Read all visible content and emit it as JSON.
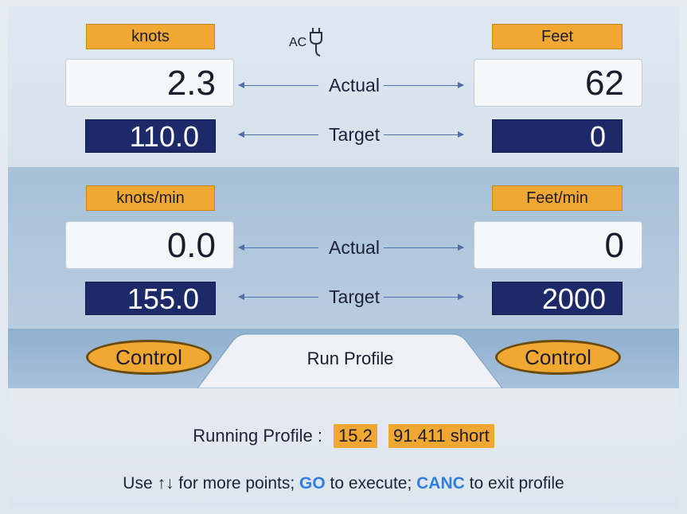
{
  "top": {
    "left_unit": "knots",
    "right_unit": "Feet",
    "power_label": "AC",
    "actual_label": "Actual",
    "target_label": "Target",
    "left_actual": "2.3",
    "left_target": "110.0",
    "right_actual": "62",
    "right_target": "0"
  },
  "middle": {
    "left_unit": "knots/min",
    "right_unit": "Feet/min",
    "actual_label": "Actual",
    "target_label": "Target",
    "left_actual": "0.0",
    "left_target": "155.0",
    "right_actual": "0",
    "right_target": "2000"
  },
  "tabs": {
    "left_control": "Control",
    "center": "Run Profile",
    "right_control": "Control"
  },
  "status": {
    "running_label": "Running Profile :",
    "value_1": "15.2",
    "value_2": "91.411 short"
  },
  "hint": {
    "part1": "Use ↑↓ for more points; ",
    "go": "GO",
    "part2": " to execute; ",
    "canc": "CANC",
    "part3": " to exit profile"
  },
  "colors": {
    "orange": "#f0a832",
    "navy": "#1c2a6a",
    "blue_keyword": "#2e7fe0"
  }
}
